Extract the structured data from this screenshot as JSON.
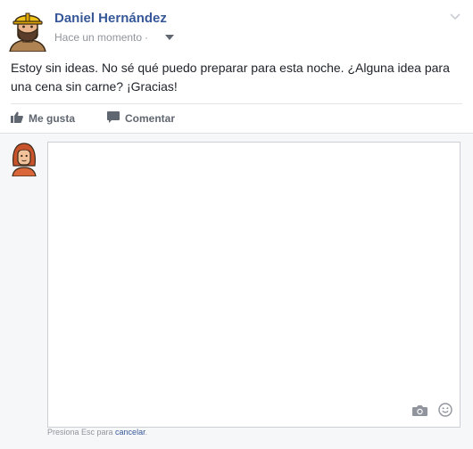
{
  "post": {
    "author": "Daniel Hernández",
    "timestamp": "Hace un momento",
    "separator": "·",
    "text": "Estoy sin ideas. No sé qué puedo preparar para esta noche. ¿Alguna idea para una cena sin carne? ¡Gracias!",
    "menu_icon": "chevron-down-icon",
    "privacy_icon": "caret-down-icon"
  },
  "actions": {
    "like_label": "Me gusta",
    "comment_label": "Comentar"
  },
  "comment": {
    "placeholder": "",
    "hint_prefix": "Presiona Esc para ",
    "hint_link": "cancelar",
    "hint_suffix": ".",
    "camera_icon": "camera-icon",
    "emoji_icon": "smiley-icon"
  },
  "colors": {
    "author": "#365899",
    "meta": "#90949c",
    "action": "#606770",
    "comments_bg": "#f6f7f9"
  }
}
